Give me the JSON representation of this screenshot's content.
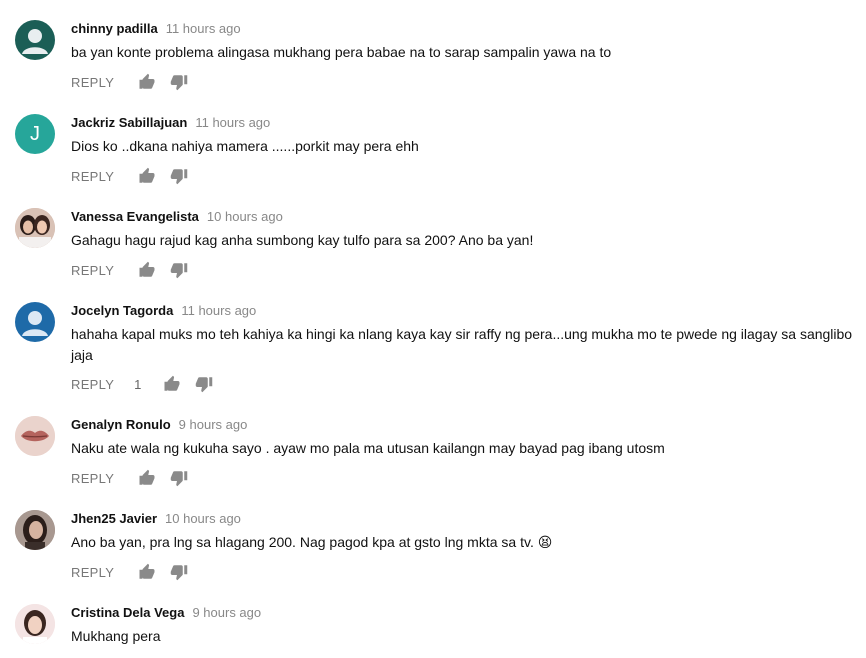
{
  "reply_label": "REPLY",
  "comments": [
    {
      "author": "chinny padilla",
      "time": "11 hours ago",
      "text": "ba yan konte problema alingasa mukhang pera babae na to sarap sampalin yawa na to",
      "avatar": {
        "type": "default-person-icon",
        "bg": "#1b5e56"
      },
      "likes": ""
    },
    {
      "author": "Jackriz Sabillajuan",
      "time": "11 hours ago",
      "text": "Dios ko ..dkana nahiya mamera ......porkit may pera ehh",
      "avatar": {
        "type": "letter",
        "letter": "J",
        "bg": "#26a69a"
      },
      "likes": ""
    },
    {
      "author": "Vanessa Evangelista",
      "time": "10 hours ago",
      "text": "Gahagu hagu rajud kag anha sumbong kay tulfo para sa 200? Ano ba yan!",
      "avatar": {
        "type": "photo-two-people",
        "bg": "#c9a99a"
      },
      "likes": ""
    },
    {
      "author": "Jocelyn Tagorda",
      "time": "11 hours ago",
      "text": "hahaha kapal muks mo teh kahiya ka hingi ka nlang kaya kay sir raffy ng pera...ung mukha mo te pwede ng ilagay sa sanglibo jaja",
      "avatar": {
        "type": "default-person-icon",
        "bg": "#1e6aa8"
      },
      "likes": "1"
    },
    {
      "author": "Genalyn Ronulo",
      "time": "9 hours ago",
      "text": "Naku ate wala ng kukuha sayo . ayaw mo pala ma utusan kailangn may bayad pag ibang utosm",
      "avatar": {
        "type": "photo-lips",
        "bg": "#e8cfc8"
      },
      "likes": ""
    },
    {
      "author": "Jhen25 Javier",
      "time": "10 hours ago",
      "text": "Ano ba yan, pra lng sa hlagang 200. Nag pagod kpa at gsto lng mkta sa tv. 😫",
      "avatar": {
        "type": "photo-woman",
        "bg": "#8c7a72"
      },
      "likes": ""
    },
    {
      "author": "Cristina Dela Vega",
      "time": "9 hours ago",
      "text": "Mukhang pera",
      "avatar": {
        "type": "photo-woman-light",
        "bg": "#f2dede"
      },
      "likes": ""
    }
  ]
}
